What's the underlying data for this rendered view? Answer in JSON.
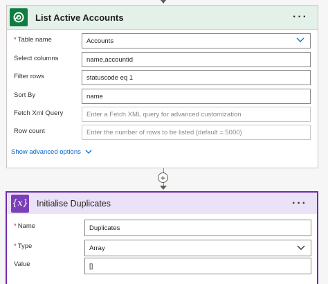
{
  "card1": {
    "title": "List Active Accounts",
    "more": "···",
    "fields": [
      {
        "label": "Table name",
        "required": true,
        "value": "Accounts",
        "placeholder": ""
      },
      {
        "label": "Select columns",
        "required": false,
        "value": "name,accountid",
        "placeholder": ""
      },
      {
        "label": "Filter rows",
        "required": false,
        "value": "statuscode eq 1",
        "placeholder": ""
      },
      {
        "label": "Sort By",
        "required": false,
        "value": "name",
        "placeholder": ""
      },
      {
        "label": "Fetch Xml Query",
        "required": false,
        "value": "",
        "placeholder": "Enter a Fetch XML query for advanced customization"
      },
      {
        "label": "Row count",
        "required": false,
        "value": "",
        "placeholder": "Enter the number of rows to be listed (default = 5000)"
      }
    ],
    "advanced": "Show advanced options"
  },
  "plus": "+",
  "card2": {
    "title": "Initialise Duplicates",
    "more": "···",
    "icon_text": "{x}",
    "fields": [
      {
        "label": "Name",
        "required": true,
        "value": "Duplicates"
      },
      {
        "label": "Type",
        "required": true,
        "value": "Array"
      },
      {
        "label": "Value",
        "required": false,
        "value": "[]"
      }
    ]
  },
  "colors": {
    "dataverse_green": "#107c41",
    "variable_purple": "#6d2bb1",
    "link_blue": "#0066cc"
  }
}
